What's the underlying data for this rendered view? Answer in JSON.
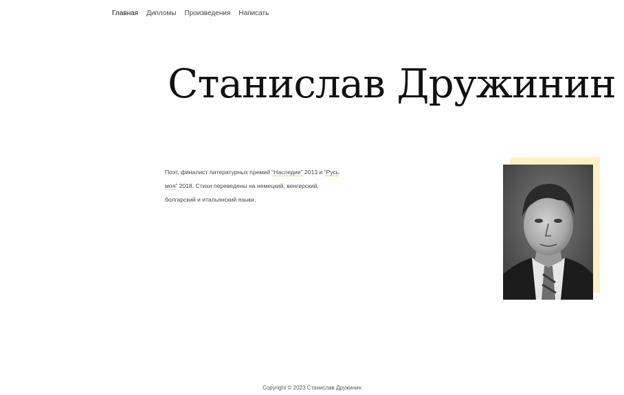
{
  "nav": {
    "items": [
      {
        "label": "Главная"
      },
      {
        "label": "Дипломы"
      },
      {
        "label": "Произведения"
      },
      {
        "label": "Написать"
      }
    ]
  },
  "hero": {
    "title": "Станислав Дружинин"
  },
  "bio": {
    "part1": "Поэт, финалист литературных премий ",
    "award1": "“Наследие”",
    "part2": " 2013 и ",
    "award2": "“Русь моя”",
    "part3": " 2018. Стихи переведены на немецкий, венгерский, болгарский и итальянский языки."
  },
  "footer": {
    "copyright": "Copyright © 2023 Станислав Дружинин"
  }
}
